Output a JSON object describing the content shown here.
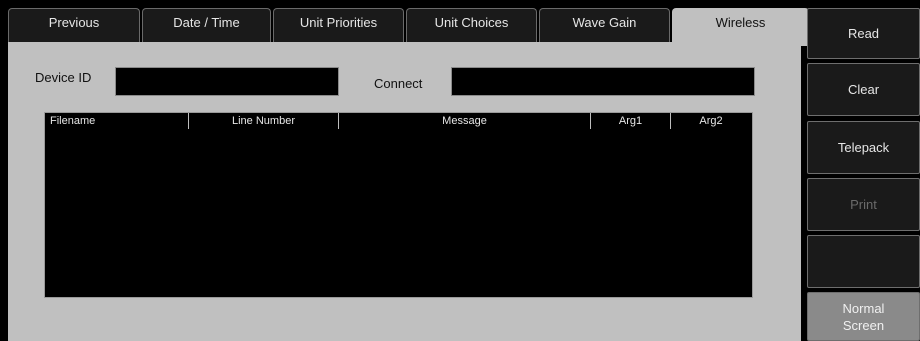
{
  "tabs": [
    {
      "label": "Previous"
    },
    {
      "label": "Date / Time"
    },
    {
      "label": "Unit Priorities"
    },
    {
      "label": "Unit Choices"
    },
    {
      "label": "Wave Gain"
    },
    {
      "label": "Wireless",
      "active": true
    }
  ],
  "form": {
    "device_id_label": "Device ID",
    "device_id_value": "",
    "connect_label": "Connect",
    "connect_value": ""
  },
  "log_table": {
    "columns": [
      "Filename",
      "Line Number",
      "Message",
      "Arg1",
      "Arg2"
    ],
    "rows": []
  },
  "side_buttons": {
    "read": "Read",
    "clear": "Clear",
    "telepack": "Telepack",
    "print": "Print",
    "blank": "",
    "normal_line1": "Normal",
    "normal_line2": "Screen"
  },
  "colors": {
    "panel": "#c0c0c0",
    "button": "#1a1a1a",
    "active_button": "#8a8a8a",
    "disabled_text": "#6a6a6a"
  }
}
